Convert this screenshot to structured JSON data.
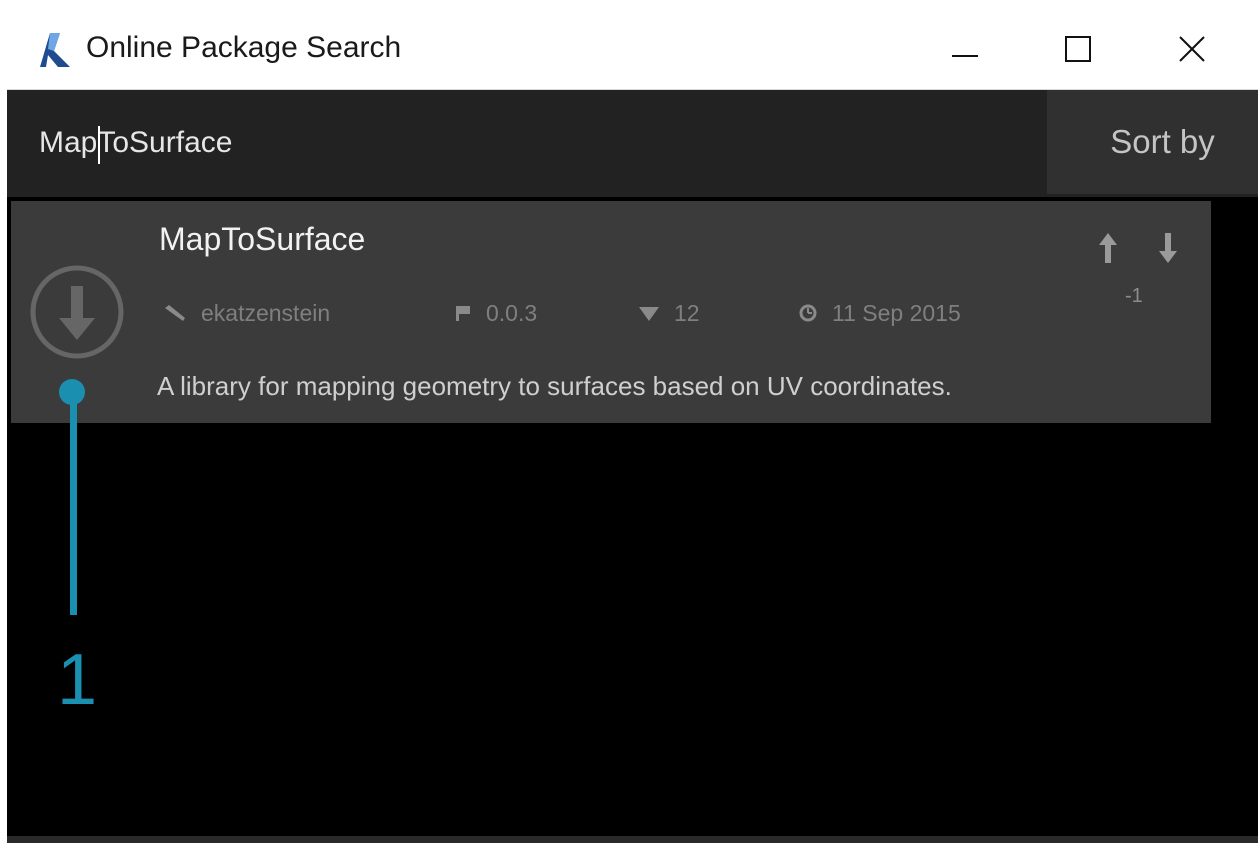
{
  "window": {
    "title": "Online Package Search",
    "controls": {
      "minimize": "minimize-icon",
      "maximize": "maximize-icon",
      "close": "close-icon"
    }
  },
  "search": {
    "value_before_caret": "Map",
    "value_after_caret": "ToSurface",
    "sort_label": "Sort by"
  },
  "results": [
    {
      "name": "MapToSurface",
      "author": "ekatzenstein",
      "version": "0.0.3",
      "downloads": "12",
      "date": "11 Sep 2015",
      "description": "A library for mapping geometry to surfaces based on UV coordinates.",
      "votes": "-1"
    }
  ],
  "callout": {
    "number": "1"
  },
  "colors": {
    "accent": "#1b8fb0",
    "card_bg": "#3b3b3b",
    "search_bg": "#222222",
    "window_bg": "#000000"
  }
}
